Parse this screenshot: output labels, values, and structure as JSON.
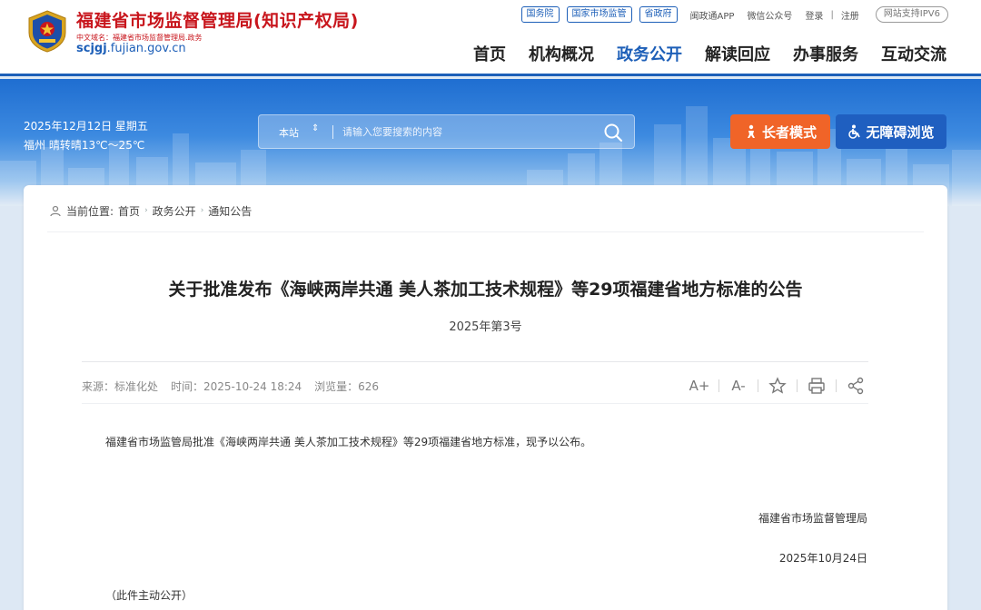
{
  "header": {
    "site_title": "福建省市场监督管理局(知识产权局)",
    "cn_domain": "中文域名：福建省市场监督管理局.政务",
    "en_domain_bold": "scjgj",
    "en_domain_rest": ".fujian.gov.cn",
    "top_links": [
      "国务院",
      "国家市场监管",
      "省政府"
    ],
    "app_link": "闽政通APP",
    "wechat_link": "微信公众号",
    "login": "登录",
    "divider": "|",
    "register": "注册",
    "ipv6": "网站支持IPV6"
  },
  "nav": {
    "items": [
      "首页",
      "机构概况",
      "政务公开",
      "解读回应",
      "办事服务",
      "互动交流"
    ],
    "active_index": 2
  },
  "banner": {
    "date_line": "2025年12月12日 星期五",
    "weather_line": "福州 晴转晴13℃～25℃",
    "search_scope": "本站",
    "search_placeholder": "请输入您要搜索的内容",
    "elder_mode": "长者模式",
    "accessible_browse": "无障碍浏览"
  },
  "breadcrumb": {
    "prefix": "当前位置:",
    "items": [
      "首页",
      "政务公开",
      "通知公告"
    ]
  },
  "article": {
    "title": "关于批准发布《海峡两岸共通 美人茶加工技术规程》等29项福建省地方标准的公告",
    "doc_number": "2025年第3号",
    "source": "来源：标准化处",
    "time": "时间：2025-10-24 18:24",
    "views": "浏览量：626",
    "tools": {
      "font_up": "A+",
      "font_down": "A-"
    },
    "body": "福建省市场监管局批准《海峡两岸共通 美人茶加工技术规程》等29项福建省地方标准，现予以公布。",
    "signature_org": "福建省市场监督管理局",
    "signature_date": "2025年10月24日",
    "public_note": "（此件主动公开）"
  },
  "colors": {
    "brand_red": "#c8161d",
    "brand_blue": "#1d5fb8",
    "elder_orange": "#f06428"
  }
}
